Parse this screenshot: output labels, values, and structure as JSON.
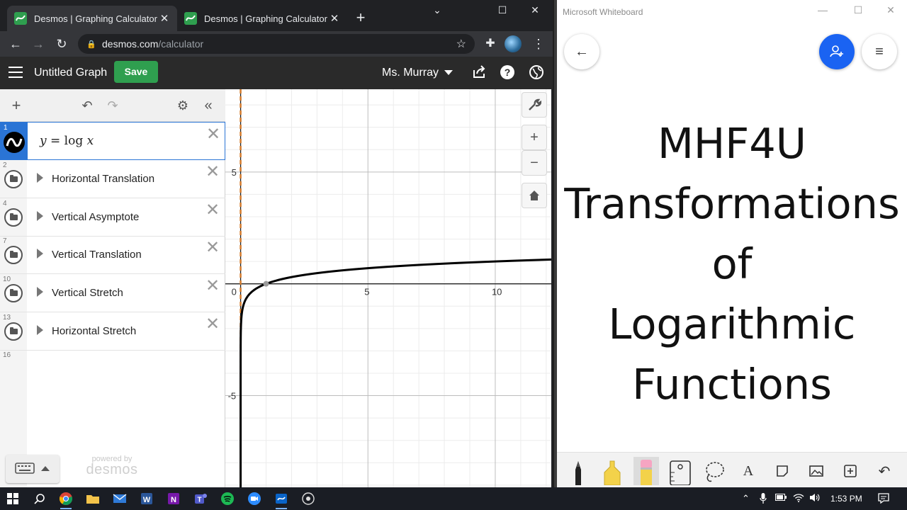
{
  "browser": {
    "tabs": [
      {
        "title": "Desmos | Graphing Calculator",
        "active": true
      },
      {
        "title": "Desmos | Graphing Calculator",
        "active": false
      }
    ],
    "new_tab_label": "+",
    "minimize": "⌄",
    "restore": "☐",
    "close": "✕",
    "url_host": "desmos.com",
    "url_path": "/calculator"
  },
  "desmos": {
    "graph_title": "Untitled Graph",
    "save_label": "Save",
    "user_name": "Ms. Murray",
    "expressions": [
      {
        "num": "1",
        "text_y": "y",
        "text_eq": " = ",
        "text_log": "log",
        "text_x": " x"
      },
      {
        "num": "2",
        "label": "Horizontal Translation"
      },
      {
        "num": "4",
        "label": "Vertical Asymptote"
      },
      {
        "num": "7",
        "label": "Vertical Translation"
      },
      {
        "num": "10",
        "label": "Vertical Stretch"
      },
      {
        "num": "13",
        "label": "Horizontal Stretch"
      }
    ],
    "empty_row_num": "16",
    "powered_by": "powered by",
    "brand": "desmos",
    "axis_labels": {
      "x": [
        "0",
        "5",
        "10"
      ],
      "y": [
        "5",
        "-5"
      ]
    },
    "curve": {
      "function": "log x",
      "x_range": [
        -0.6,
        12.2
      ],
      "y_range": [
        -9.1,
        8.7
      ],
      "asymptote_x": 0,
      "highlight_point": [
        1,
        0
      ]
    },
    "colors": {
      "curve": "#000000",
      "asymptote": "#d57a2a",
      "save": "#2f9f4f",
      "selected": "#2a74d5"
    }
  },
  "whiteboard": {
    "app_title": "Microsoft Whiteboard",
    "lines": [
      "MHF4U",
      "Transformations",
      "of",
      "Logarithmic",
      "Functions"
    ],
    "accent": "#1a63f2"
  },
  "taskbar": {
    "time": "1:53 PM"
  }
}
